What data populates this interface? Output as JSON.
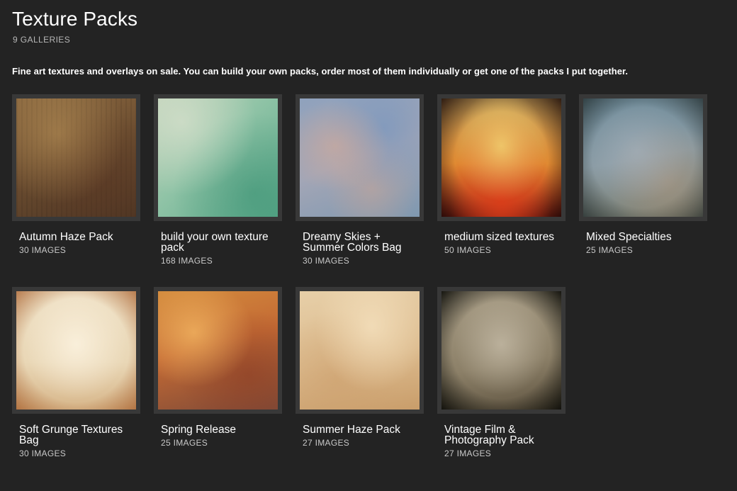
{
  "header": {
    "title": "Texture Packs",
    "gallery_count": "9 GALLERIES"
  },
  "description": "Fine art textures and overlays on sale. You can build your own packs, order most of them individually or get one of the packs I put together.",
  "galleries": [
    {
      "title": "Autumn Haze Pack",
      "count": "30 IMAGES"
    },
    {
      "title": "build your own texture pack",
      "count": "168 IMAGES"
    },
    {
      "title": "Dreamy Skies + Summer Colors Bag",
      "count": "30 IMAGES"
    },
    {
      "title": "medium sized textures",
      "count": "50 IMAGES"
    },
    {
      "title": "Mixed Specialties",
      "count": "25 IMAGES"
    },
    {
      "title": "Soft Grunge Textures Bag",
      "count": "30 IMAGES"
    },
    {
      "title": "Spring Release",
      "count": "25 IMAGES"
    },
    {
      "title": "Summer Haze Pack",
      "count": "27 IMAGES"
    },
    {
      "title": "Vintage Film & Photography Pack",
      "count": "27 IMAGES"
    }
  ]
}
